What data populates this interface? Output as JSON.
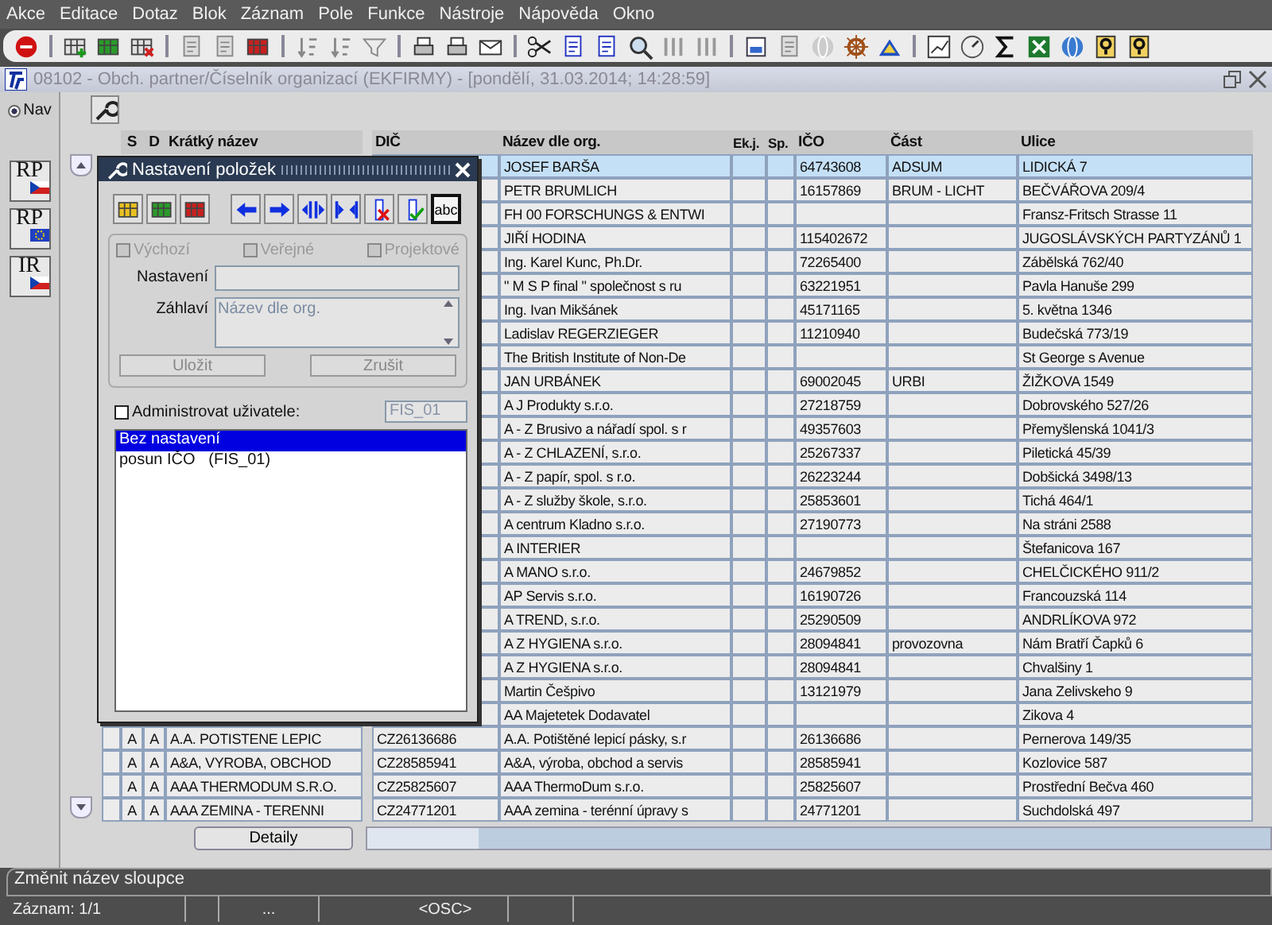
{
  "menu": [
    "Akce",
    "Editace",
    "Dotaz",
    "Blok",
    "Záznam",
    "Pole",
    "Funkce",
    "Nástroje",
    "Nápověda",
    "Okno"
  ],
  "window": {
    "title": "08102 - Obch. partner/Číselník organizací (EKFIRMY) - [pondělí, 31.03.2014; 14:28:59]"
  },
  "nav": {
    "label": "Nav",
    "selected": true
  },
  "side_buttons": [
    {
      "label": "RP",
      "kind": "cz"
    },
    {
      "label": "RP",
      "kind": "eu"
    },
    {
      "label": "IR",
      "kind": "cz"
    }
  ],
  "table": {
    "columns": [
      "S",
      "D",
      "Krátký název",
      "DIČ",
      "Název dle org.",
      "Ek.j.",
      "Sp.",
      "IČO",
      "Část",
      "Ulice"
    ],
    "rows": [
      {
        "name": "JOSEF BARŠA",
        "ico": "64743608",
        "part": "ADSUM",
        "street": "LIDICKÁ 7",
        "selected": true
      },
      {
        "name": "PETR BRUMLICH",
        "ico": "16157869",
        "part": "BRUM - LICHT",
        "street": "BEČVÁŘOVA 209/4",
        "selected": false
      },
      {
        "name": "FH 00 FORSCHUNGS & ENTWI",
        "street": "Fransz-Fritsch Strasse 11",
        "selected": false
      },
      {
        "name": "JIŘÍ HODINA",
        "ico": "115402672",
        "street": "JUGOSLÁVSKÝCH PARTYZÁNŮ 1",
        "selected": false
      },
      {
        "name": "Ing. Karel Kunc, Ph.Dr.",
        "ico": "72265400",
        "street": "Zábělská 762/40",
        "selected": false
      },
      {
        "name": "\" M S P  final \" společnost s ru",
        "ico": "63221951",
        "street": "Pavla Hanuše 299",
        "selected": false
      },
      {
        "name": "Ing. Ivan Mikšánek",
        "ico": "45171165",
        "street": "5. května 1346",
        "selected": false
      },
      {
        "name": "Ladislav REGERZIEGER",
        "ico": "11210940",
        "street": "Budečská 773/19",
        "selected": false
      },
      {
        "name": " The British Institute of Non-De",
        "street": "St George s Avenue",
        "selected": false
      },
      {
        "name": "JAN URBÁNEK",
        "ico": "69002045",
        "part": "URBI",
        "street": "ŽIŽKOVA 1549",
        "selected": false
      },
      {
        "name": "A  J  Produkty s.r.o.",
        "ico": "27218759",
        "street": "Dobrovského 527/26",
        "selected": false
      },
      {
        "name": "A - Z Brusivo a nářadí spol. s r",
        "ico": "49357603",
        "street": "Přemyšlenská 1041/3",
        "selected": false
      },
      {
        "name": "A - Z CHLAZENÍ, s.r.o.",
        "ico": "25267337",
        "street": "Piletická 45/39",
        "selected": false
      },
      {
        "name": "A - Z papír, spol. s r.o.",
        "ico": "26223244",
        "street": "Dobšická 3498/13",
        "selected": false
      },
      {
        "name": "A - Z služby škole, s.r.o.",
        "ico": "25853601",
        "street": "Tichá 464/1",
        "selected": false
      },
      {
        "name": "A centrum Kladno s.r.o.",
        "ico": "27190773",
        "street": "Na stráni 2588",
        "selected": false
      },
      {
        "name": "A INTERIER",
        "street": "Štefanicova 167",
        "selected": false
      },
      {
        "name": "A MANO  s.r.o.",
        "ico": "24679852",
        "street": "CHELČICKÉHO 911/2",
        "selected": false
      },
      {
        "name": "AP Servis s.r.o.",
        "ico": "16190726",
        "street": "Francouzská 114",
        "selected": false
      },
      {
        "name": "A TREND, s.r.o.",
        "ico": "25290509",
        "street": "ANDRLÍKOVA 972",
        "selected": false
      },
      {
        "name": "A Z HYGIENA s.r.o.",
        "ico": "28094841",
        "part": "provozovna",
        "street": "Nám Bratří Čapků 6",
        "selected": false
      },
      {
        "name": "A Z HYGIENA s.r.o.",
        "ico": "28094841",
        "street": "Chvalšiny 1",
        "selected": false
      },
      {
        "name": "Martin Češpivo",
        "ico": "13121979",
        "street": "Jana Zelivskeho 9",
        "selected": false
      },
      {
        "name": "AA Majetetek Dodavatel",
        "street": "Zikova 4",
        "selected": false
      },
      {
        "s": "A",
        "d": "A",
        "short": "A.A. POTISTENE LEPIC",
        "dic": "CZ26136686",
        "name": "A.A. Potištěné lepicí pásky, s.r",
        "ico": "26136686",
        "street": "Pernerova 149/35",
        "selected": false
      },
      {
        "s": "A",
        "d": "A",
        "short": "A&A, VYROBA, OBCHOD",
        "dic": "CZ28585941",
        "name": "A&A, výroba, obchod a servis",
        "ico": "28585941",
        "street": "Kozlovice 587",
        "selected": false
      },
      {
        "s": "A",
        "d": "A",
        "short": "AAA THERMODUM S.R.O.",
        "dic": "CZ25825607",
        "name": "AAA ThermoDum s.r.o.",
        "ico": "25825607",
        "street": "Prostřední Bečva 460",
        "selected": false
      },
      {
        "s": "A",
        "d": "A",
        "short": "AAA ZEMINA - TERENNI",
        "dic": "CZ24771201",
        "name": "AAA zemina - terénní úpravy s",
        "ico": "24771201",
        "street": "Suchdolská 497",
        "selected": false
      }
    ]
  },
  "details_button": "Detaily",
  "dialog": {
    "title": "Nastavení položek",
    "text_tool": {
      "label": "abc",
      "pressed": true
    },
    "checkboxes": [
      {
        "label": "Výchozí",
        "checked": false,
        "disabled": true
      },
      {
        "label": "Veřejné",
        "checked": false,
        "disabled": true
      },
      {
        "label": "Projektové",
        "checked": false,
        "disabled": true
      }
    ],
    "setting_field": {
      "label": "Nastavení"
    },
    "header_field": {
      "label": "Záhlaví",
      "value": "Název dle org."
    },
    "buttons": [
      {
        "label": "Uložit",
        "disabled": true
      },
      {
        "label": "Zrušit",
        "disabled": true
      }
    ],
    "admin": {
      "label": "Administrovat uživatele:",
      "checked": false
    },
    "user_field": {
      "value": "FIS_01"
    },
    "list": [
      {
        "label": "Bez nastavení",
        "selected": true
      },
      {
        "label": "posun IČO   (FIS_01)",
        "selected": false
      }
    ]
  },
  "status": {
    "message": "Změnit název sloupce",
    "record": "Záznam: 1/1",
    "fields": [
      "...",
      "<OSC>"
    ]
  }
}
